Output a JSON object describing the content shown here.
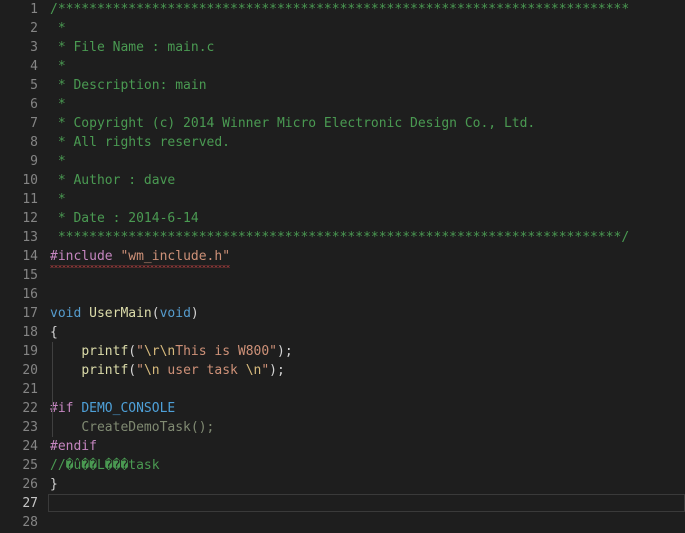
{
  "editor": {
    "language": "c",
    "theme": "dark",
    "background": "#1e1e1e",
    "gutter_color": "#858585",
    "active_line_number": 27,
    "total_lines": 28,
    "colors": {
      "comment": "#4a9a52",
      "preprocessor": "#c586c0",
      "string": "#ce9178",
      "escape": "#d7ba7d",
      "keyword": "#569ccd",
      "function": "#dcdcaa",
      "punctuation": "#d4d4d4",
      "dimmed": "#808a72",
      "macro": "#4ea0d8",
      "error_underline": "#f14c4c"
    }
  },
  "lines": [
    {
      "n": "1",
      "text": "/*************************************************************************"
    },
    {
      "n": "2",
      "text": " *"
    },
    {
      "n": "3",
      "text": " * File Name : main.c"
    },
    {
      "n": "4",
      "text": " *"
    },
    {
      "n": "5",
      "text": " * Description: main"
    },
    {
      "n": "6",
      "text": " *"
    },
    {
      "n": "7",
      "text": " * Copyright (c) 2014 Winner Micro Electronic Design Co., Ltd."
    },
    {
      "n": "8",
      "text": " * All rights reserved."
    },
    {
      "n": "9",
      "text": " *"
    },
    {
      "n": "10",
      "text": " * Author : dave"
    },
    {
      "n": "11",
      "text": " *"
    },
    {
      "n": "12",
      "text": " * Date : 2014-6-14"
    },
    {
      "n": "13",
      "text": " ************************************************************************/"
    },
    {
      "n": "14",
      "text": "#include \"wm_include.h\"",
      "parts": {
        "directive": "#include",
        "space": " ",
        "header": "\"wm_include.h\""
      }
    },
    {
      "n": "15",
      "text": ""
    },
    {
      "n": "16",
      "text": ""
    },
    {
      "n": "17",
      "text": "void UserMain(void)",
      "parts": {
        "kw1": "void",
        "sp1": " ",
        "name": "UserMain",
        "p1": "(",
        "kw2": "void",
        "p2": ")"
      }
    },
    {
      "n": "18",
      "text": "{"
    },
    {
      "n": "19",
      "text": "    printf(\"\\r\\nThis is W800\");",
      "parts": {
        "indent": "    ",
        "fn": "printf",
        "p1": "(",
        "q1": "\"",
        "e1": "\\r",
        "e2": "\\n",
        "s1": "This is W800",
        "q2": "\"",
        "p2": ")",
        "semi": ";"
      }
    },
    {
      "n": "20",
      "text": "    printf(\"\\n user task \\n\");",
      "parts": {
        "indent": "    ",
        "fn": "printf",
        "p1": "(",
        "q1": "\"",
        "e1": "\\n",
        "s1": " user task ",
        "e2": "\\n",
        "q2": "\"",
        "p2": ")",
        "semi": ";"
      }
    },
    {
      "n": "21",
      "text": ""
    },
    {
      "n": "22",
      "text": "#if DEMO_CONSOLE",
      "parts": {
        "directive": "#if",
        "space": " ",
        "macro": "DEMO_CONSOLE"
      }
    },
    {
      "n": "23",
      "text": "    CreateDemoTask();",
      "parts": {
        "indent": "    ",
        "call": "CreateDemoTask();"
      }
    },
    {
      "n": "24",
      "text": "#endif",
      "parts": {
        "directive": "#endif"
      }
    },
    {
      "n": "25",
      "text": "//�û��L���task"
    },
    {
      "n": "26",
      "text": "}"
    },
    {
      "n": "27",
      "text": ""
    },
    {
      "n": "28",
      "text": ""
    }
  ]
}
